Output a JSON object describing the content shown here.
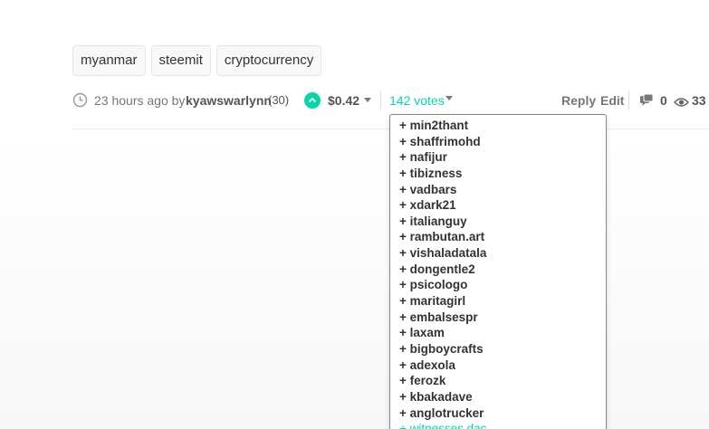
{
  "tags": [
    "myanmar",
    "steemit",
    "cryptocurrency"
  ],
  "meta": {
    "time": "23 hours ago by",
    "author": "kyawswarlynn",
    "reputation": "(30)",
    "payout": "$0.42",
    "votes": "142 votes",
    "reply": "Reply",
    "edit": "Edit",
    "comments": "0",
    "views": "33"
  },
  "voters": [
    "+ min2thant",
    "+ shaffrimohd",
    "+ nafijur",
    "+ tibizness",
    "+ vadbars",
    "+ xdark21",
    "+ italianguy",
    "+ rambutan.art",
    "+ vishaladatala",
    "+ dongentle2",
    "+ psicologo",
    "+ maritagirl",
    "+ embalsespr",
    "+ laxam",
    "+ bigboycrafts",
    "+ adexola",
    "+ ferozk",
    "+ kbakadave",
    "+ anglotrucker",
    "+ witnesses.dac"
  ],
  "colors": {
    "accent": "#06d6a9",
    "text": "#333333",
    "muted": "#777777"
  },
  "icons": [
    "clock-icon",
    "upvote-icon",
    "comment-icon",
    "eye-icon"
  ]
}
